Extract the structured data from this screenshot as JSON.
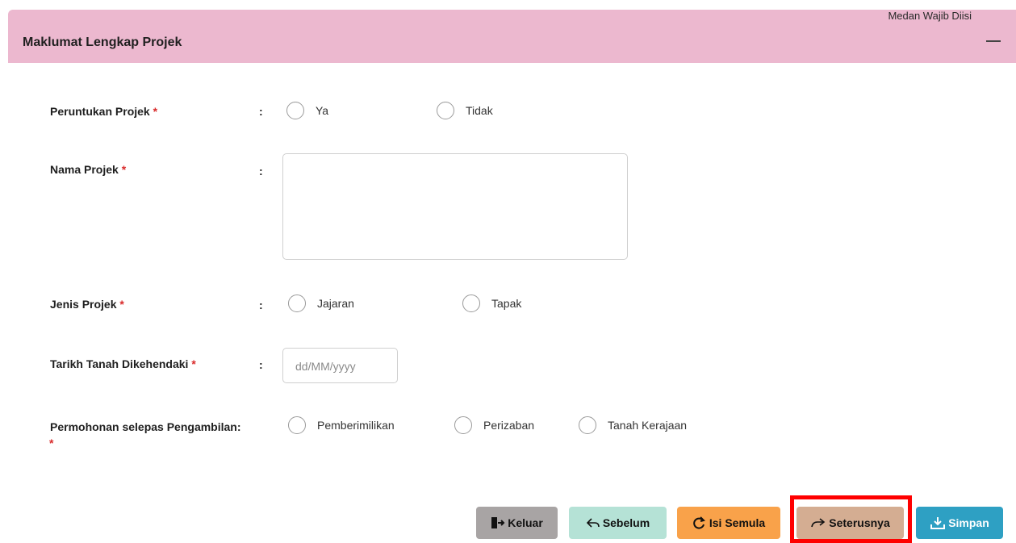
{
  "panel": {
    "title": "Maklumat Lengkap Projek",
    "required_note": "Medan Wajib Diisi"
  },
  "form": {
    "required_mark": "*",
    "colon": ":",
    "peruntukan": {
      "label": "Peruntukan Projek",
      "options": [
        "Ya",
        "Tidak"
      ]
    },
    "nama": {
      "label": "Nama Projek",
      "value": ""
    },
    "jenis": {
      "label": "Jenis Projek",
      "options": [
        "Jajaran",
        "Tapak"
      ]
    },
    "tarikh": {
      "label": "Tarikh Tanah Dikehendaki",
      "placeholder": "dd/MM/yyyy"
    },
    "permohonan": {
      "label": "Permohonan selepas Pengambilan:",
      "options": [
        "Pemberimilikan",
        "Perizaban",
        "Tanah Kerajaan"
      ]
    }
  },
  "buttons": {
    "keluar": "Keluar",
    "sebelum": "Sebelum",
    "isi_semula": "Isi Semula",
    "seterusnya": "Seterusnya",
    "simpan": "Simpan"
  },
  "colors": {
    "header_bg": "#ecb8cf",
    "required": "#d92b2b",
    "highlight": "#ff0000",
    "btn_keluar": "#a8a4a4",
    "btn_sebelum": "#b5e2d6",
    "btn_isi_semula": "#f9a24a",
    "btn_seterusnya": "#d4ad92",
    "btn_simpan": "#2ea0c3"
  }
}
